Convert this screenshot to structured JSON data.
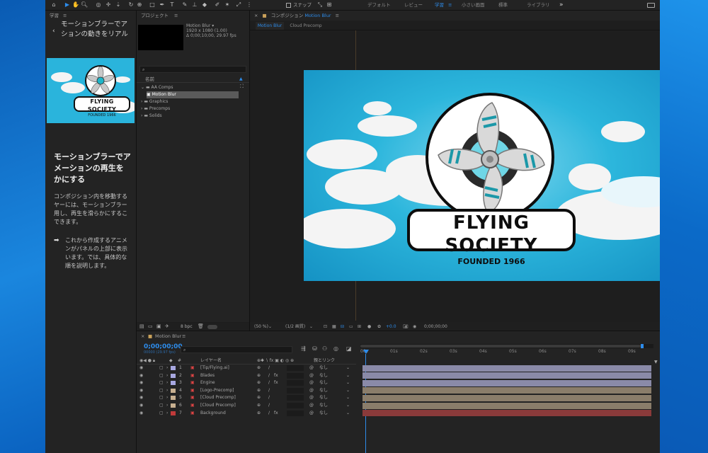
{
  "toolbar": {
    "home_icon": "home-icon",
    "snap_label": "スナップ",
    "workspaces": [
      "デフォルト",
      "レビュー",
      "学習",
      "小さい画面",
      "標準",
      "ライブラリ"
    ],
    "active_workspace": "学習",
    "more": "»"
  },
  "learn": {
    "panel_title": "学習",
    "back_text": "モーションブラーでア\nションの動きをリアル",
    "heading": "モーションブラーでア\nメーションの再生を\nかにする",
    "paragraph": "コンポジション内を移動する\nヤーには、モーションブラー\n用し、再生を滑らかにするこ\nできます。",
    "bullet": "これから作成するアニメ\nンがパネルの上部に表示\nいます。では、具体的な\n順を説明します。",
    "thumb_logo": "FLYING SOCIETY",
    "thumb_sub": "FOUNDED 1966"
  },
  "project": {
    "title": "プロジェクト",
    "item_name": "Motion Blur ▾",
    "item_info1": "1920 x 1080 (1.00)",
    "item_info2": "Δ 0;00;10;00, 29.97 fps",
    "col_name": "名前",
    "tree": [
      {
        "label": "AA Comps",
        "indent": 0,
        "open": true
      },
      {
        "label": "Motion Blur",
        "indent": 1,
        "selected": true
      },
      {
        "label": "Graphics",
        "indent": 0
      },
      {
        "label": "Precomps",
        "indent": 0
      },
      {
        "label": "Solids",
        "indent": 0
      }
    ],
    "bpc": "8 bpc"
  },
  "comp": {
    "panel_title": "コンポジション",
    "comp_name": "Motion Blur",
    "tabs": [
      "Motion Blur",
      "Cloud Precomp"
    ],
    "logo_title": "FLYING SOCIETY",
    "logo_sub": "FOUNDED 1966",
    "zoom": "(50 %)",
    "resolution": "(1/2 画質)",
    "exposure": "+0.0",
    "timecode": "0;00;00;00"
  },
  "timeline": {
    "tab": "Motion Blur",
    "timecode": "0;00;00;00",
    "frame_info": "00000 (29.97 fps)",
    "col_layer": "レイヤー名",
    "col_parent": "親とリンク",
    "ruler": [
      "00s",
      "01s",
      "02s",
      "03s",
      "04s",
      "05s",
      "06s",
      "07s",
      "08s",
      "09s"
    ],
    "layers": [
      {
        "num": "1",
        "name": "[Tip/Flying.ai]",
        "parent": "なし",
        "color": "#a8a8e0",
        "bar": "#8a8aa8",
        "fx": false
      },
      {
        "num": "2",
        "name": "Blades",
        "parent": "なし",
        "color": "#a8a8e0",
        "bar": "#8a8aa8",
        "fx": true
      },
      {
        "num": "3",
        "name": "Engine",
        "parent": "なし",
        "color": "#a8a8e0",
        "bar": "#8a8aa8",
        "fx": true
      },
      {
        "num": "4",
        "name": "[Logo-Precomp]",
        "parent": "なし",
        "color": "#c8b090",
        "bar": "#8a7d6a",
        "fx": false
      },
      {
        "num": "5",
        "name": "[Cloud Precomp]",
        "parent": "なし",
        "color": "#c8b090",
        "bar": "#8a7d6a",
        "fx": false
      },
      {
        "num": "6",
        "name": "[Cloud Precomp]",
        "parent": "なし",
        "color": "#c8b090",
        "bar": "#8a7d6a",
        "fx": false
      },
      {
        "num": "7",
        "name": "Background",
        "parent": "なし",
        "color": "#c03a3a",
        "bar": "#8a3a3a",
        "fx": true
      }
    ]
  },
  "colors": {
    "accent": "#2d8ceb",
    "sky": "#2cb6dc"
  }
}
